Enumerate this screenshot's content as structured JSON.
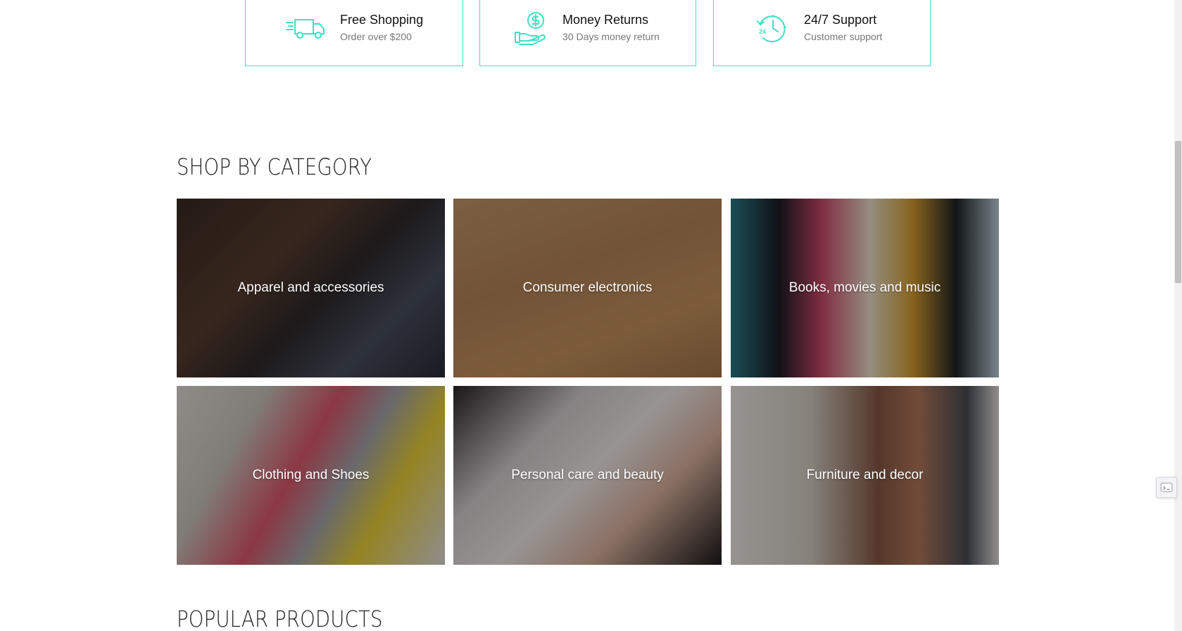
{
  "features": [
    {
      "title": "Free Shopping",
      "subtitle": "Order over $200",
      "icon": "delivery-truck-icon"
    },
    {
      "title": "Money Returns",
      "subtitle": "30 Days money return",
      "icon": "money-hand-icon"
    },
    {
      "title": "24/7 Support",
      "subtitle": "Customer support",
      "icon": "clock-24-icon"
    }
  ],
  "categories_section": {
    "title": "SHOP BY CATEGORY",
    "items": [
      {
        "label": "Apparel and accessories"
      },
      {
        "label": "Consumer electronics"
      },
      {
        "label": "Books, movies and music"
      },
      {
        "label": "Clothing and Shoes"
      },
      {
        "label": "Personal care and beauty"
      },
      {
        "label": "Furniture and decor"
      }
    ]
  },
  "popular_section": {
    "title": "POPULAR PRODUCTS"
  },
  "colors": {
    "accent": "#3fe0c4",
    "overlay": "#000000"
  }
}
